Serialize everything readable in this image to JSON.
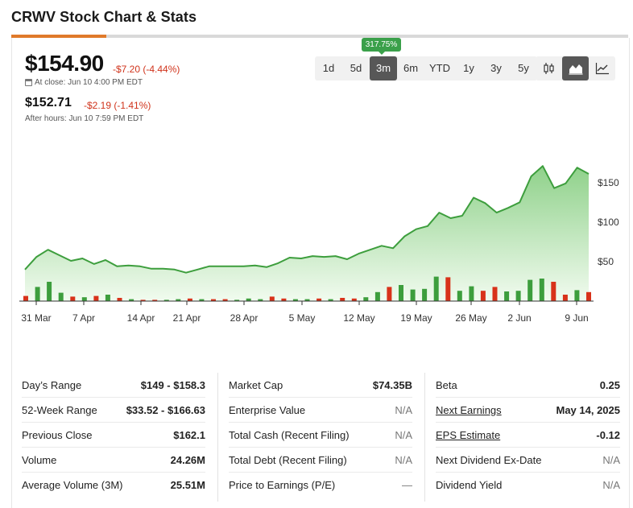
{
  "page": {
    "title": "CRWV Stock Chart & Stats"
  },
  "quote": {
    "price": "$154.90",
    "change": "-$7.20 (-4.44%)",
    "close_time": "At close: Jun 10 4:00 PM EDT",
    "after_hours_price": "$152.71",
    "after_hours_change": "-$2.19 (-1.41%)",
    "after_hours_time": "After hours: Jun 10 7:59 PM EDT"
  },
  "range": {
    "badge": "317.75%",
    "buttons": [
      "1d",
      "5d",
      "3m",
      "6m",
      "YTD",
      "1y",
      "3y",
      "5y"
    ],
    "selected": "3m"
  },
  "chart_type": {
    "buttons": [
      "candlestick-icon",
      "area-chart-icon",
      "line-chart-icon"
    ],
    "selected": "area-chart-icon"
  },
  "chart_data": {
    "type": "area",
    "x_ticks": [
      "31 Mar",
      "7 Apr",
      "14 Apr",
      "21 Apr",
      "28 Apr",
      "5 May",
      "12 May",
      "19 May",
      "26 May",
      "2 Jun",
      "9 Jun"
    ],
    "y_ticks": [
      "$50",
      "$100",
      "$150"
    ],
    "ylim": [
      0,
      160
    ],
    "price": [
      40,
      56,
      65,
      58,
      51,
      54,
      47,
      52,
      44,
      45,
      44,
      41,
      41,
      40,
      36,
      40,
      44,
      44,
      44,
      44,
      45,
      43,
      48,
      55,
      54,
      57,
      56,
      57,
      53,
      60,
      65,
      70,
      67,
      82,
      91,
      95,
      112,
      105,
      108,
      131,
      124,
      112,
      118,
      125,
      158,
      171,
      143,
      149,
      169,
      161
    ],
    "volume": [
      8,
      22,
      30,
      13,
      7,
      6,
      8,
      10,
      5,
      3,
      2,
      2,
      2,
      3,
      4,
      3,
      3,
      3,
      2,
      4,
      3,
      7,
      4,
      3,
      3,
      4,
      3,
      5,
      4,
      6,
      14,
      22,
      25,
      18,
      19,
      38,
      37,
      16,
      23,
      16,
      22,
      15,
      16,
      33,
      35,
      30,
      10,
      17,
      14
    ],
    "volume_direction": [
      "r",
      "g",
      "g",
      "g",
      "r",
      "g",
      "r",
      "g",
      "r",
      "g",
      "r",
      "r",
      "g",
      "g",
      "r",
      "g",
      "r",
      "r",
      "g",
      "g",
      "g",
      "r",
      "r",
      "g",
      "g",
      "r",
      "g",
      "r",
      "r",
      "g",
      "g",
      "r",
      "g",
      "g",
      "g",
      "g",
      "r",
      "g",
      "g",
      "r",
      "r",
      "g",
      "g",
      "g",
      "g",
      "r",
      "r",
      "g",
      "r"
    ],
    "colors": {
      "up": "#3d9e3d",
      "down": "#d8321a",
      "line": "#3d9e3d",
      "fill_top": "#8fd18a",
      "fill_bottom": "#f1fbef"
    }
  },
  "stats": {
    "col1": [
      {
        "label": "Day’s Range",
        "value": "$149 - $158.3"
      },
      {
        "label": "52-Week Range",
        "value": "$33.52 - $166.63"
      },
      {
        "label": "Previous Close",
        "value": "$162.1"
      },
      {
        "label": "Volume",
        "value": "24.26M"
      },
      {
        "label": "Average Volume (3M)",
        "value": "25.51M"
      }
    ],
    "col2": [
      {
        "label": "Market Cap",
        "value": "$74.35B"
      },
      {
        "label": "Enterprise Value",
        "value": "N/A"
      },
      {
        "label": "Total Cash (Recent Filing)",
        "value": "N/A"
      },
      {
        "label": "Total Debt (Recent Filing)",
        "value": "N/A"
      },
      {
        "label": "Price to Earnings (P/E)",
        "value": "—"
      }
    ],
    "col3": [
      {
        "label": "Beta",
        "value": "0.25"
      },
      {
        "label": "Next Earnings",
        "value": "May 14, 2025"
      },
      {
        "label": "EPS Estimate",
        "value": "-0.12"
      },
      {
        "label": "Next Dividend Ex-Date",
        "value": "N/A"
      },
      {
        "label": "Dividend Yield",
        "value": "N/A"
      }
    ]
  }
}
